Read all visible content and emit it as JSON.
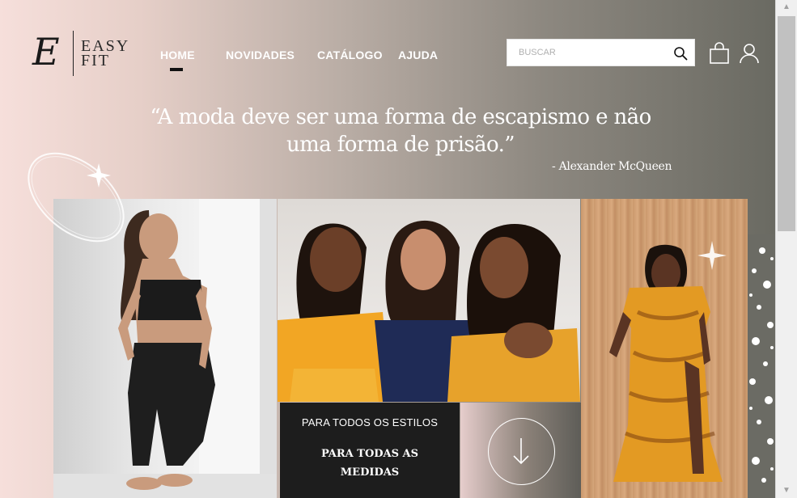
{
  "brand": {
    "mark": "E",
    "line1": "EASY",
    "line2": "FIT"
  },
  "nav": {
    "items": [
      {
        "label": "HOME",
        "active": true
      },
      {
        "label": "NOVIDADES",
        "active": false
      },
      {
        "label": "CATÁLOGO",
        "active": false
      },
      {
        "label": "AJUDA",
        "active": false
      }
    ]
  },
  "search": {
    "placeholder": "BUSCAR",
    "value": "",
    "icon": "search-icon"
  },
  "header_icons": [
    "shopping-bag-icon",
    "user-icon"
  ],
  "hero": {
    "quote_line1": "“A moda deve ser uma forma de escapismo e não",
    "quote_line2": "uma forma de prisão.”",
    "author": "- Alexander McQueen",
    "tagline1": "PARA TODOS OS ESTILOS",
    "tagline2": "PARA TODAS AS MEDIDAS",
    "scroll_icon": "arrow-down-icon"
  },
  "colors": {
    "nav_text": "#ffffff",
    "cta_bg": "#1d1d1d",
    "accent_dark": "#111111"
  }
}
